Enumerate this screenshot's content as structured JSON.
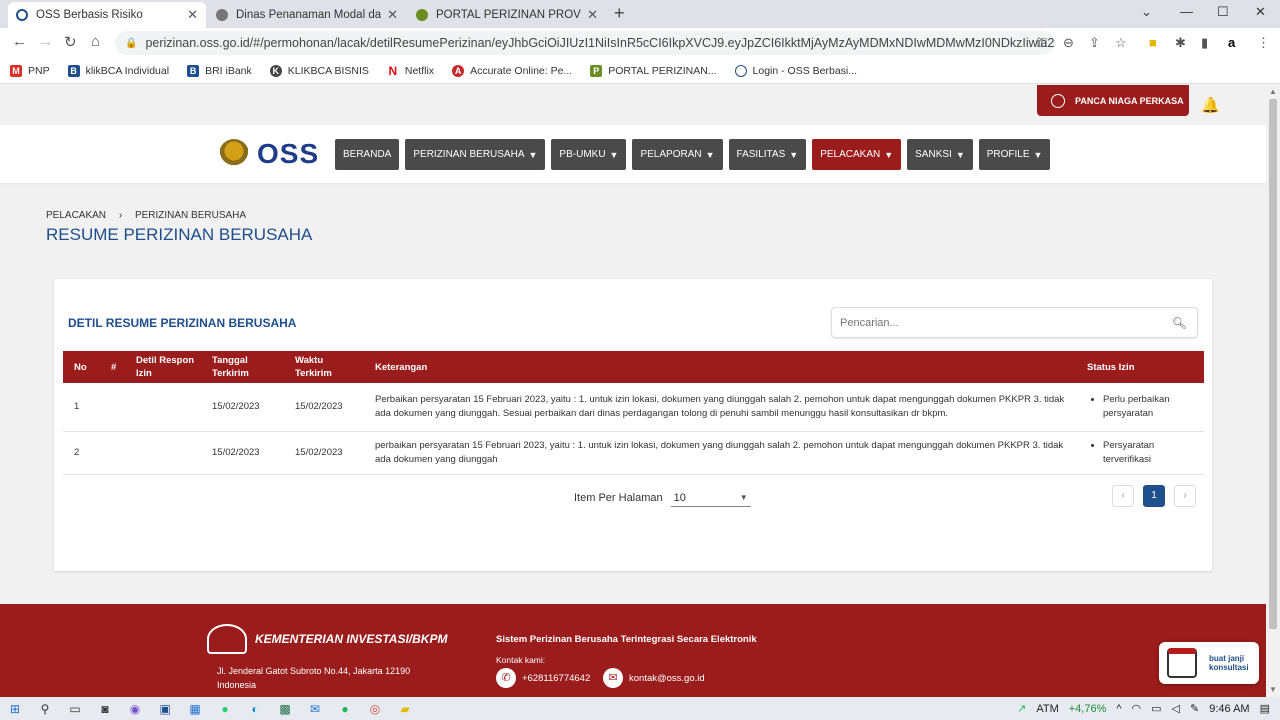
{
  "browser": {
    "tabs": [
      {
        "title": "OSS Berbasis Risiko",
        "active": true,
        "favicon_color": "#1f4e8c"
      },
      {
        "title": "Dinas Penanaman Modal dan Pel",
        "active": false,
        "favicon_color": "#666666"
      },
      {
        "title": "PORTAL PERIZINAN PROV JAWA",
        "active": false,
        "favicon_color": "#6b8e23"
      }
    ],
    "url": "perizinan.oss.go.id/#/permohonan/lacak/detilResumePerizinan/eyJhbGciOiJIUzI1NiIsInR5cCI6IkpXVCJ9.eyJpZCI6IkktMjAyMzAyMDMxNDIwMDMwMzI0NDkzIiwia2wiOiJLZ...",
    "bookmarks": [
      {
        "label": "PNP",
        "color": "#d93025",
        "glyph": "M"
      },
      {
        "label": "klikBCA Individual",
        "color": "#1f4e8c",
        "glyph": "B"
      },
      {
        "label": "BRI iBank",
        "color": "#1f4e8c",
        "glyph": "B"
      },
      {
        "label": "KLIKBCA BISNIS",
        "color": "#444444",
        "glyph": "K"
      },
      {
        "label": "Netflix",
        "color": "#e50914",
        "glyph": "N"
      },
      {
        "label": "Accurate Online: Pe...",
        "color": "#c62828",
        "glyph": "A"
      },
      {
        "label": "PORTAL PERIZINAN...",
        "color": "#6b8e23",
        "glyph": "P"
      },
      {
        "label": "Login - OSS Berbasi...",
        "color": "#1f4e8c",
        "glyph": "O"
      }
    ]
  },
  "topbar": {
    "user_name": "PANCA NIAGA PERKASA"
  },
  "header": {
    "logo_text": "OSS",
    "menu": [
      {
        "label": "BERANDA",
        "chevron": false,
        "active": false
      },
      {
        "label": "PERIZINAN BERUSAHA",
        "chevron": true,
        "active": false
      },
      {
        "label": "PB-UMKU",
        "chevron": true,
        "active": false
      },
      {
        "label": "PELAPORAN",
        "chevron": true,
        "active": false
      },
      {
        "label": "FASILITAS",
        "chevron": true,
        "active": false
      },
      {
        "label": "PELACAKAN",
        "chevron": true,
        "active": true
      },
      {
        "label": "SANKSI",
        "chevron": true,
        "active": false
      },
      {
        "label": "PROFILE",
        "chevron": true,
        "active": false
      }
    ]
  },
  "breadcrumb": {
    "first": "PELACAKAN",
    "separator": "›",
    "second": "PERIZINAN BERUSAHA"
  },
  "page_title": "RESUME PERIZINAN BERUSAHA",
  "card": {
    "title": "DETIL RESUME PERIZINAN BERUSAHA",
    "search_placeholder": "Pencarian...",
    "columns": [
      "No",
      "#",
      "Detil Respon Izin",
      "Tanggal Terkirim",
      "Waktu Terkirim",
      "Keterangan",
      "Status Izin"
    ],
    "rows": [
      {
        "no": "1",
        "hash": "",
        "detil": "",
        "tanggal": "15/02/2023",
        "waktu": "15/02/2023",
        "keterangan": "Perbaikan persyaratan 15 Februari 2023, yaitu : 1. untuk izin lokasi, dokumen yang diunggah salah 2. pemohon untuk dapat mengunggah dokumen PKKPR 3. tidak ada dokumen yang diunggah. Sesuai perbaikan dari dinas perdagangan tolong di penuhi sambil menunggu hasil konsultasikan dr bkpm.",
        "status": "Perlu perbaikan persyaratan"
      },
      {
        "no": "2",
        "hash": "",
        "detil": "",
        "tanggal": "15/02/2023",
        "waktu": "15/02/2023",
        "keterangan": "perbaikan persyaratan 15 Februari 2023, yaitu : 1. untuk izin lokasi, dokumen yang diunggah salah 2. pemohon untuk dapat mengunggah dokumen PKKPR 3. tidak ada dokumen yang diunggah",
        "status": "Persyaratan terverifikasi"
      }
    ],
    "pager": {
      "label": "Item Per Halaman",
      "per_page": "10",
      "current_page": "1",
      "prev": "‹",
      "next": "›"
    }
  },
  "footer": {
    "org": "KEMENTERIAN INVESTASI/BKPM",
    "address_line1": "Jl. Jenderal Gatot Subroto No.44, Jakarta 12190",
    "address_line2": "Indonesia",
    "system_name": "Sistem Perizinan Berusaha Terintegrasi Secara Elektronik",
    "contact_label": "Kontak kami:",
    "phone": "+628116774642",
    "email": "kontak@oss.go.id"
  },
  "floating": {
    "line1": "buat janji",
    "line2": "konsultasi"
  },
  "taskbar": {
    "stock_label": "ATM",
    "stock_change": "+4,76%",
    "time": "9:46 AM"
  },
  "colors": {
    "primary": "#9b1c1c",
    "accent_blue": "#1f4e8c",
    "menu_dark": "#4a4a4a"
  }
}
